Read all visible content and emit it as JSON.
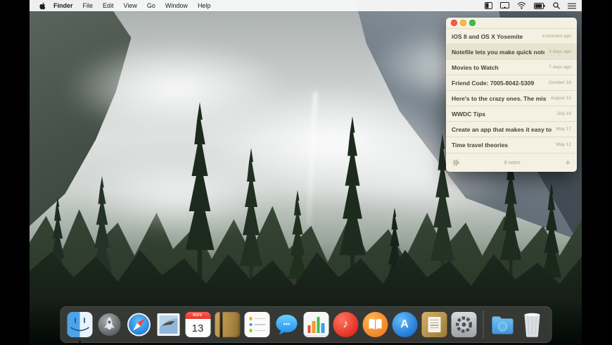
{
  "menu_bar": {
    "apple_logo": "apple-logo",
    "app_name": "Finder",
    "items": [
      "File",
      "Edit",
      "View",
      "Go",
      "Window",
      "Help"
    ],
    "status_icons": [
      "panel-toggle",
      "display-mirroring",
      "wifi",
      "battery",
      "spotlight",
      "notification-center"
    ]
  },
  "notes_window": {
    "notes": [
      {
        "title": "iOS 8 and OS X Yosemite",
        "date": "a moment ago"
      },
      {
        "title": "Notefile lets you make quick notes and s…",
        "date": "3 days ago"
      },
      {
        "title": "Movies to Watch",
        "date": "7 days ago"
      },
      {
        "title": "Friend Code: 7005-8042-5309",
        "date": "October 16"
      },
      {
        "title": "Here's to the crazy ones. The misfits. The…",
        "date": "August 15"
      },
      {
        "title": "WWDC Tips",
        "date": "July 16"
      },
      {
        "title": "Create an app that makes it easy to create…",
        "date": "May 17"
      },
      {
        "title": "Time travel theories",
        "date": "May 12"
      }
    ],
    "selected_index": 1,
    "footer": {
      "count_label": "8 notes",
      "add_label": "+"
    }
  },
  "dock": {
    "items": [
      "finder",
      "launchpad",
      "safari",
      "mail",
      "calendar",
      "contacts",
      "reminders",
      "messages",
      "numbers",
      "itunes",
      "ibooks",
      "app-store",
      "notefile",
      "system-preferences",
      "divider",
      "downloads-folder",
      "trash"
    ],
    "calendar": {
      "month": "NOV",
      "day": "13"
    }
  },
  "icons": {
    "messages_dots": "•••",
    "itunes_note": "♪",
    "appstore_letter": "A"
  },
  "colors": {
    "window_bg": "#F4F1E2",
    "row_highlight": "#E8E4D0",
    "traffic_red": "#FC5753",
    "traffic_yellow": "#FDBC40",
    "traffic_green": "#33C748",
    "menubar_bg": "#FAFAFA",
    "dock_bg": "rgba(63,65,61,0.82)"
  }
}
